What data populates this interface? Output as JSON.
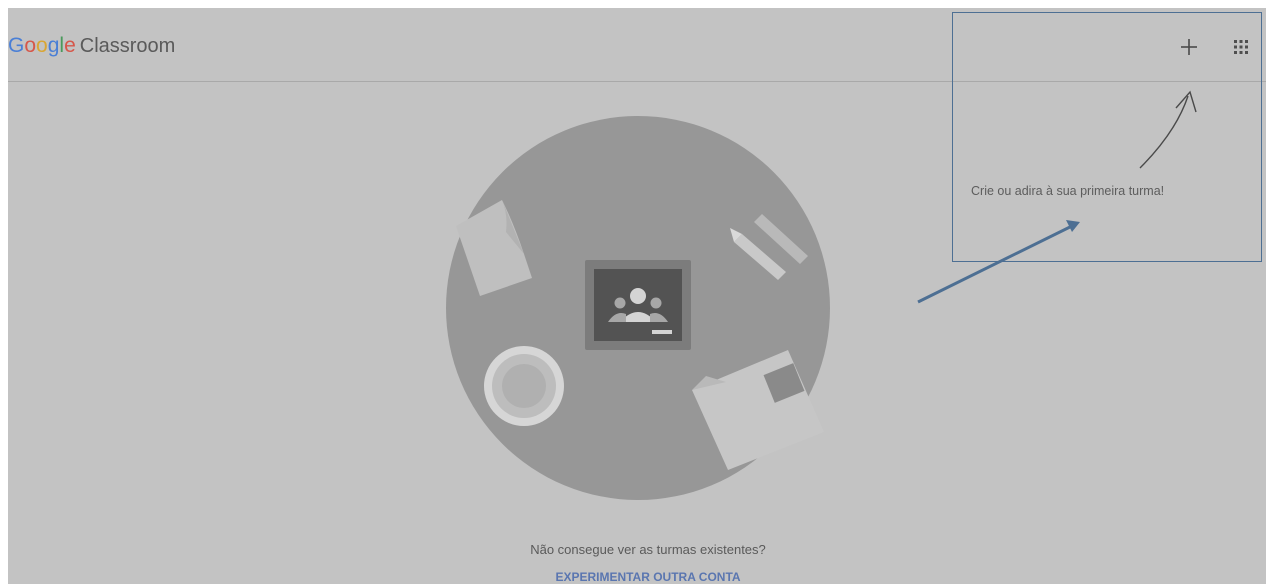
{
  "header": {
    "logo_google": [
      "G",
      "o",
      "o",
      "g",
      "l",
      "e"
    ],
    "logo_product": "Classroom",
    "create_join_icon": "plus-icon",
    "apps_icon": "apps-grid-icon"
  },
  "callout": {
    "text": "Crie ou adira à sua primeira turma!"
  },
  "main": {
    "illustration_icon": "classroom-icon",
    "cant_see_text": "Não consegue ver as turmas existentes?",
    "try_other_account": "EXPERIMENTAR OUTRA CONTA"
  },
  "colors": {
    "overlay_bg": "#c3c3c3",
    "annotation_blue": "#4d6f93",
    "link_blue": "#5a76b0",
    "google_blue": "#4285f4",
    "google_red": "#ea4335",
    "google_yellow": "#fbbc05",
    "google_green": "#34a853"
  }
}
